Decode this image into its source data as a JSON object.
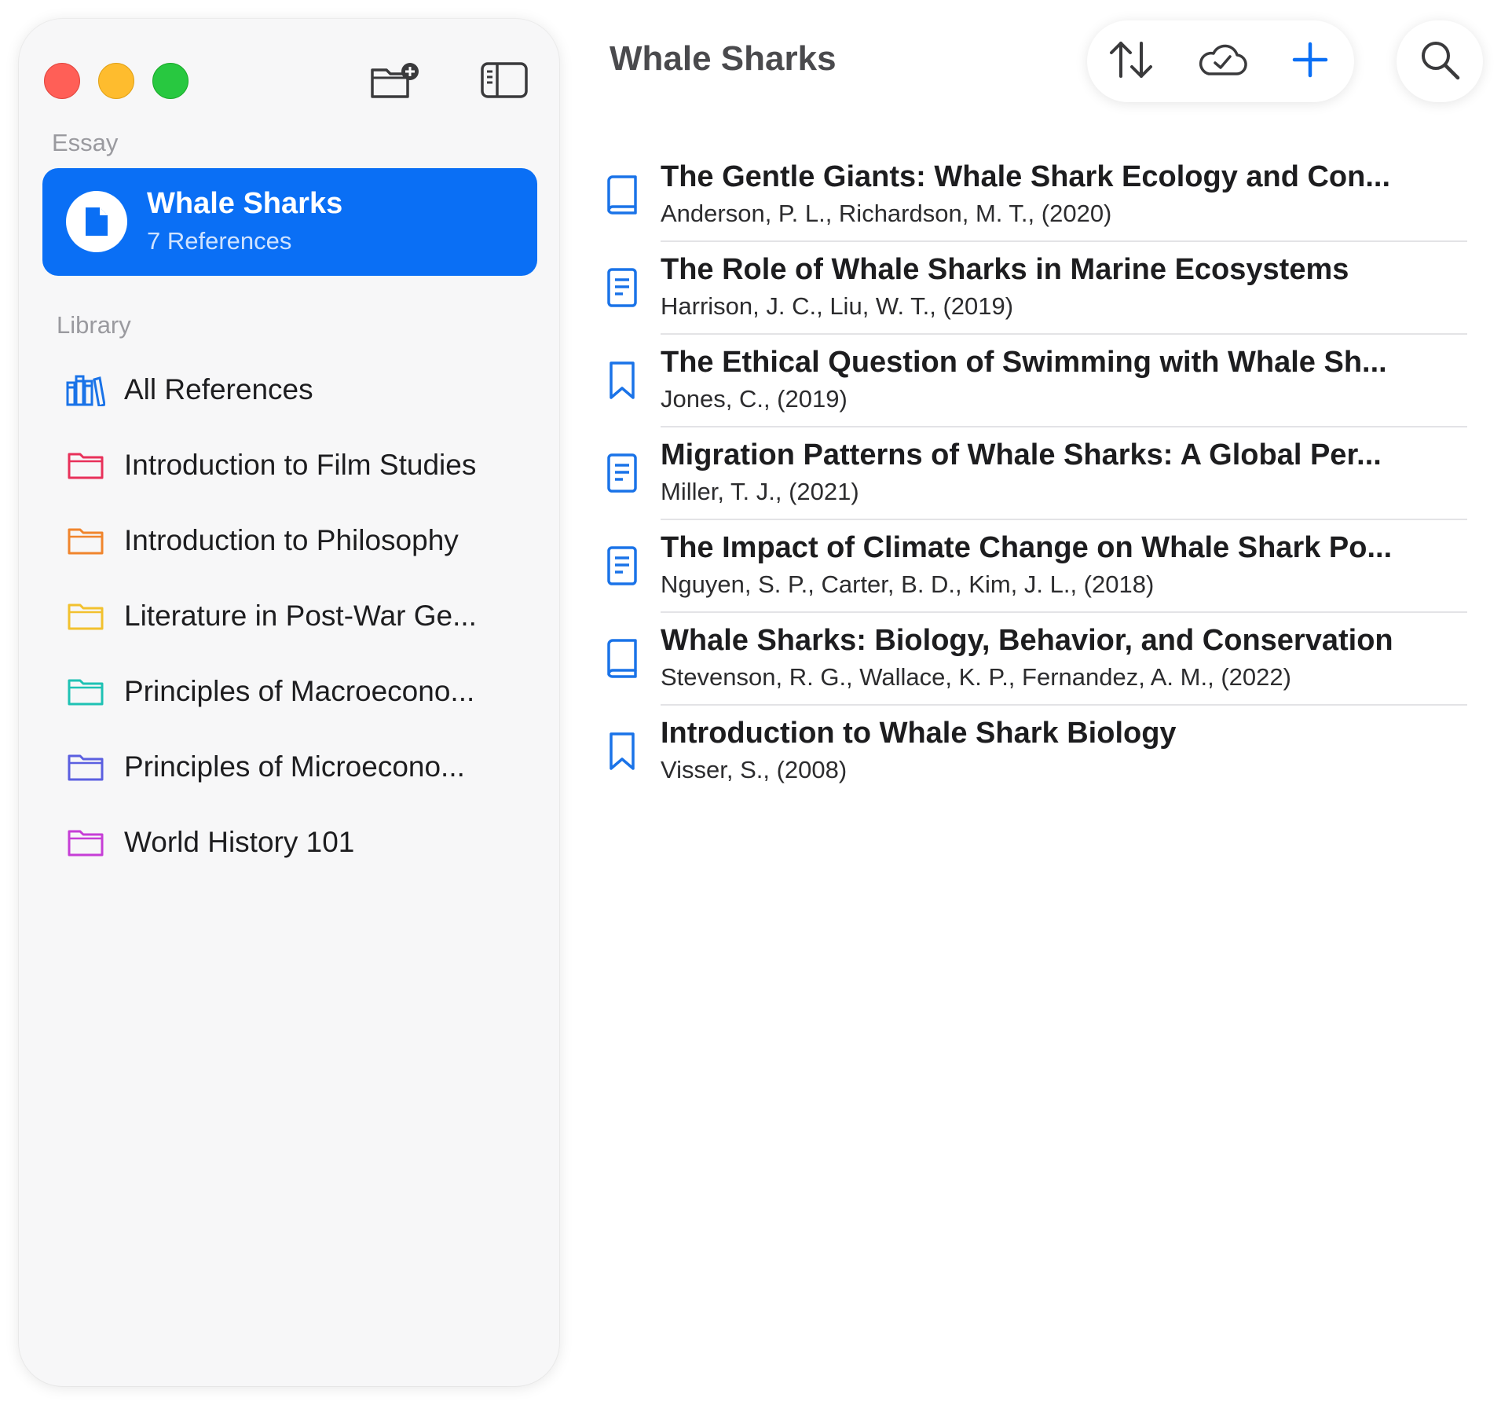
{
  "window": {
    "toolbar": {
      "new_folder_icon": "folder-badge-plus-icon",
      "sidebar_toggle_icon": "sidebar-icon"
    }
  },
  "sidebar": {
    "essay_section_label": "Essay",
    "selected_essay": {
      "title": "Whale Sharks",
      "subtitle": "7 References",
      "icon": "document-icon"
    },
    "library_section_label": "Library",
    "library_items": [
      {
        "label": "All References",
        "icon": "books-icon",
        "color": "#1a73e8"
      },
      {
        "label": "Introduction to Film Studies",
        "icon": "folder-icon",
        "color": "#e8315a"
      },
      {
        "label": "Introduction to Philosophy",
        "icon": "folder-icon",
        "color": "#f0852d"
      },
      {
        "label": "Literature in Post-War Ge...",
        "icon": "folder-icon",
        "color": "#f2c12e"
      },
      {
        "label": "Principles of Macroecono...",
        "icon": "folder-icon",
        "color": "#1fc2b4"
      },
      {
        "label": "Principles of Microecono...",
        "icon": "folder-icon",
        "color": "#5b5fe0"
      },
      {
        "label": "World History 101",
        "icon": "folder-icon",
        "color": "#c63ed6"
      }
    ]
  },
  "main": {
    "title": "Whale Sharks",
    "toolbar": {
      "sort_icon": "sort-arrows-icon",
      "sync_icon": "cloud-check-icon",
      "add_icon": "plus-icon",
      "search_icon": "search-icon"
    },
    "references": [
      {
        "title": "The Gentle Giants: Whale Shark Ecology and Con...",
        "authors": "Anderson, P. L., Richardson, M. T., (2020)",
        "icon": "book-icon"
      },
      {
        "title": "The Role of Whale Sharks in Marine Ecosystems",
        "authors": "Harrison, J. C., Liu, W. T., (2019)",
        "icon": "article-icon"
      },
      {
        "title": "The Ethical Question of Swimming with Whale Sh...",
        "authors": "Jones, C., (2019)",
        "icon": "bookmark-icon"
      },
      {
        "title": "Migration Patterns of Whale Sharks: A Global Per...",
        "authors": "Miller, T. J., (2021)",
        "icon": "article-icon"
      },
      {
        "title": "The Impact of Climate Change on Whale Shark Po...",
        "authors": "Nguyen, S. P., Carter, B. D., Kim, J. L., (2018)",
        "icon": "article-icon"
      },
      {
        "title": "Whale Sharks: Biology, Behavior, and Conservation",
        "authors": "Stevenson, R. G., Wallace, K. P., Fernandez, A. M., (2022)",
        "icon": "book-icon"
      },
      {
        "title": "Introduction to Whale Shark Biology",
        "authors": "Visser, S., (2008)",
        "icon": "bookmark-icon"
      }
    ]
  }
}
